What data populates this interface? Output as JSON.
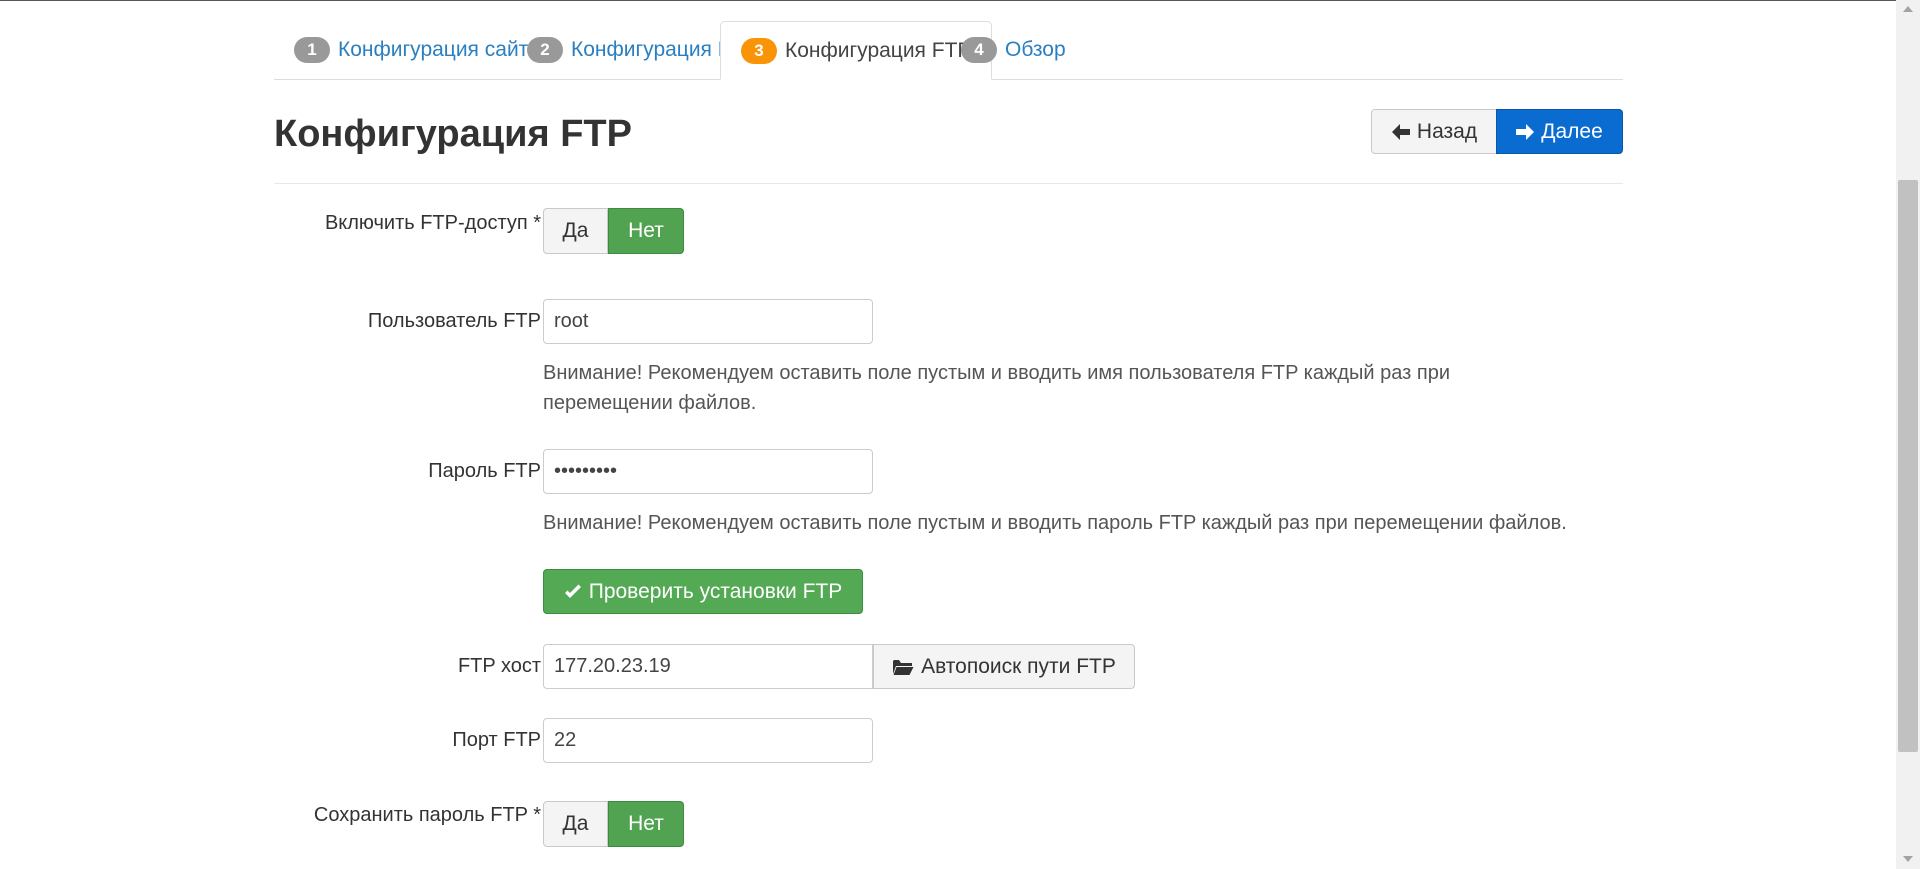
{
  "tabs": [
    {
      "number": "1",
      "label": "Конфигурация сайта"
    },
    {
      "number": "2",
      "label": "Конфигурация БД"
    },
    {
      "number": "3",
      "label": "Конфигурация FTP"
    },
    {
      "number": "4",
      "label": "Обзор"
    }
  ],
  "page": {
    "title": "Конфигурация FTP",
    "back_label": "Назад",
    "next_label": "Далее"
  },
  "form": {
    "ftp_enable": {
      "label": "Включить FTP-доступ *",
      "yes": "Да",
      "no": "Нет",
      "selected": "Нет"
    },
    "ftp_user": {
      "label": "Пользователь FTP",
      "value": "root",
      "help": "Внимание! Рекомендуем оставить поле пустым и вводить имя пользователя FTP каждый раз при перемещении файлов."
    },
    "ftp_pass": {
      "label": "Пароль FTP",
      "value": "•••••••••",
      "help": "Внимание! Рекомендуем оставить поле пустым и вводить пароль FTP каждый раз при перемещении файлов."
    },
    "check_button": "Проверить установки FTP",
    "ftp_host": {
      "label": "FTP хост",
      "value": "177.20.23.19",
      "autodetect_label": "Автопоиск пути FTP"
    },
    "ftp_port": {
      "label": "Порт FTP",
      "value": "22"
    },
    "ftp_save": {
      "label": "Сохранить пароль FTP *",
      "yes": "Да",
      "no": "Нет",
      "selected": "Нет"
    }
  },
  "colors": {
    "accent": "#0a6bd0",
    "success": "#51a351",
    "warning_badge": "#f89406",
    "link": "#2a7fc1"
  }
}
